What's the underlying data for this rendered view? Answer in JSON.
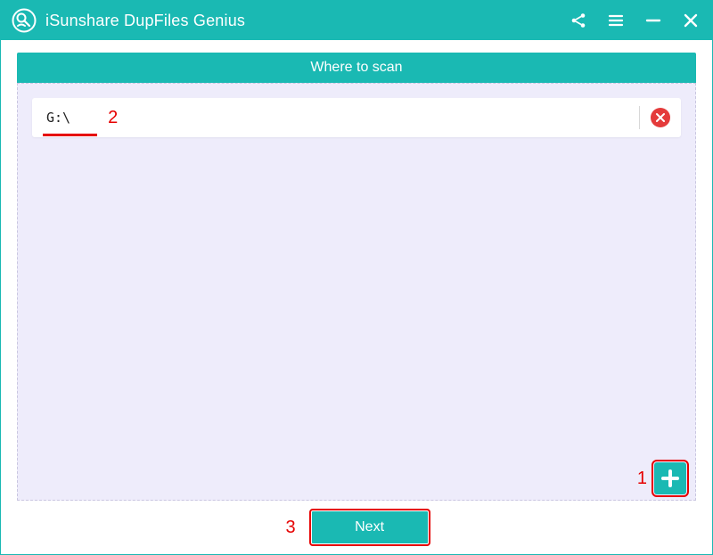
{
  "titlebar": {
    "app_name": "iSunshare DupFiles Genius"
  },
  "panel": {
    "header": "Where to scan",
    "paths": [
      {
        "value": "G:\\"
      }
    ]
  },
  "footer": {
    "next_label": "Next"
  },
  "annotations": {
    "step1": "1",
    "step2": "2",
    "step3": "3"
  }
}
